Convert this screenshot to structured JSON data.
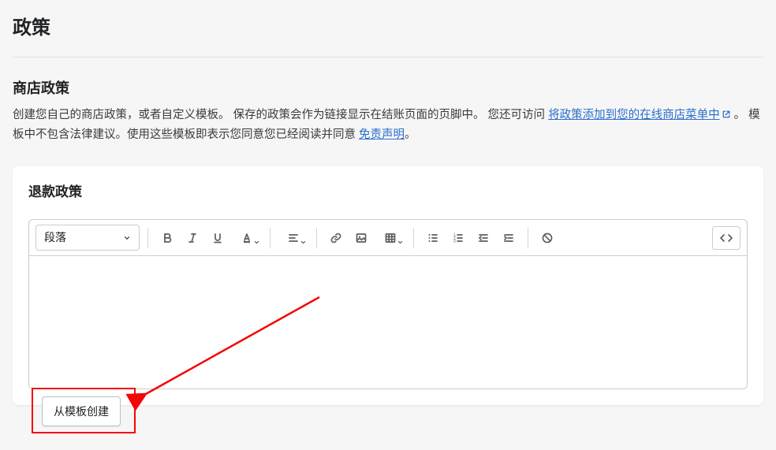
{
  "page_title": "政策",
  "section": {
    "heading": "商店政策",
    "desc_part1": "创建您自己的商店政策，或者自定义模板。 保存的政策会作为链接显示在结账页面的页脚中。 您还可访问 ",
    "link1": "将政策添加到您的在线商店菜单中",
    "desc_part2": " 。 模板中不包含法律建议。使用这些模板即表示您同意您已经阅读并同意 ",
    "link2": "免责声明",
    "desc_part3": "。"
  },
  "card": {
    "title": "退款政策",
    "style_select": "段落",
    "create_from_template": "从模板创建"
  }
}
